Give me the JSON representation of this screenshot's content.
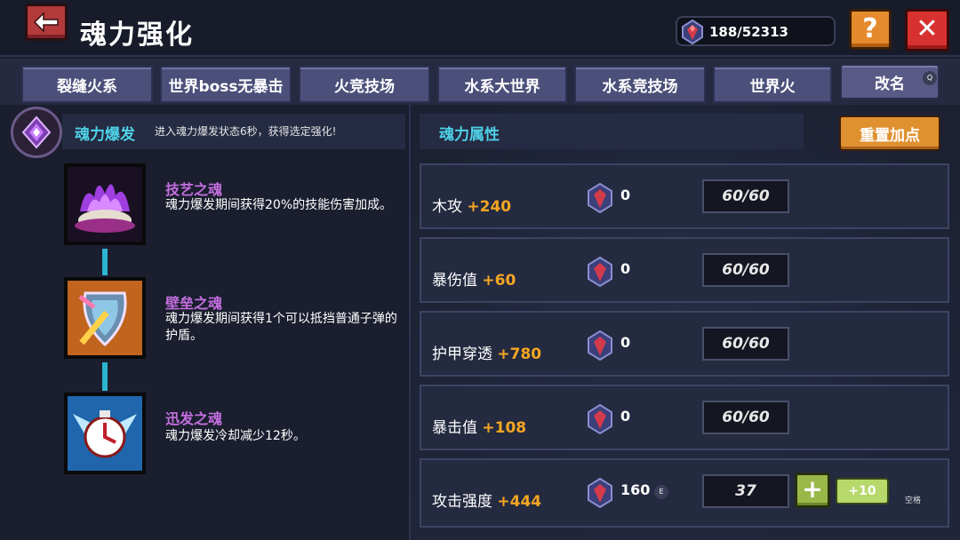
{
  "header": {
    "title": "魂力强化",
    "currency": "188/52313",
    "help_label": "?",
    "close_label": "✕"
  },
  "tabs": [
    {
      "label": "裂缝火系"
    },
    {
      "label": "世界boss无暴击"
    },
    {
      "label": "火竞技场"
    },
    {
      "label": "水系大世界"
    },
    {
      "label": "水系竞技场"
    },
    {
      "label": "世界火"
    }
  ],
  "rename": {
    "label": "改名",
    "key": "Q"
  },
  "burst": {
    "title": "魂力爆发",
    "desc": "进入魂力爆发状态6秒，获得选定强化!"
  },
  "skills": [
    {
      "name": "技艺之魂",
      "desc": "魂力爆发期间获得20%的技能伤害加成。"
    },
    {
      "name": "壁垒之魂",
      "desc": "魂力爆发期间获得1个可以抵挡普通子弹的护盾。"
    },
    {
      "name": "迅发之魂",
      "desc": "魂力爆发冷却减少12秒。"
    }
  ],
  "attributes": {
    "title": "魂力属性",
    "reset_label": "重置加点",
    "rows": [
      {
        "name": "木攻",
        "bonus": "+240",
        "cost": "0",
        "level": "60/60"
      },
      {
        "name": "暴伤值",
        "bonus": "+60",
        "cost": "0",
        "level": "60/60"
      },
      {
        "name": "护甲穿透",
        "bonus": "+780",
        "cost": "0",
        "level": "60/60"
      },
      {
        "name": "暴击值",
        "bonus": "+108",
        "cost": "0",
        "level": "60/60"
      },
      {
        "name": "攻击强度",
        "bonus": "+444",
        "cost": "160",
        "level": "37",
        "cost_key": "E",
        "plus_label": "+",
        "plus10_label": "+10",
        "space_hint": "空格"
      }
    ]
  },
  "colors": {
    "accent_cyan": "#4fd2e8",
    "bonus_orange": "#f5a623",
    "skill_purple": "#c46fe0"
  }
}
